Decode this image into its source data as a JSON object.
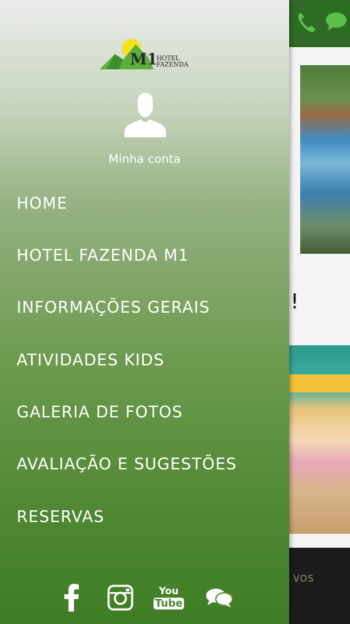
{
  "drawer": {
    "logo": {
      "m1": "M1",
      "line1": "HOTEL",
      "line2": "FAZENDA"
    },
    "account_label": "Minha conta",
    "menu": [
      {
        "label": "HOME"
      },
      {
        "label": "HOTEL FAZENDA M1"
      },
      {
        "label": "INFORMAÇÕES GERAIS"
      },
      {
        "label": "ATIVIDADES KIDS"
      },
      {
        "label": "GALERIA DE FOTOS"
      },
      {
        "label": "AVALIAÇÃO E SUGESTÕES"
      },
      {
        "label": "RESERVAS"
      }
    ],
    "social": {
      "youtube_line1": "You",
      "youtube_line2": "Tube"
    }
  },
  "background": {
    "exclaim": "!",
    "footer_text": "VOS"
  },
  "colors": {
    "drawer_top": "#ececec",
    "drawer_bottom": "#3f7d24",
    "topbar": "#2e6b25",
    "text": "#ffffff"
  },
  "icons": [
    "phone-icon",
    "chat-icon",
    "user-icon",
    "facebook-icon",
    "instagram-icon",
    "youtube-icon",
    "comments-icon"
  ]
}
